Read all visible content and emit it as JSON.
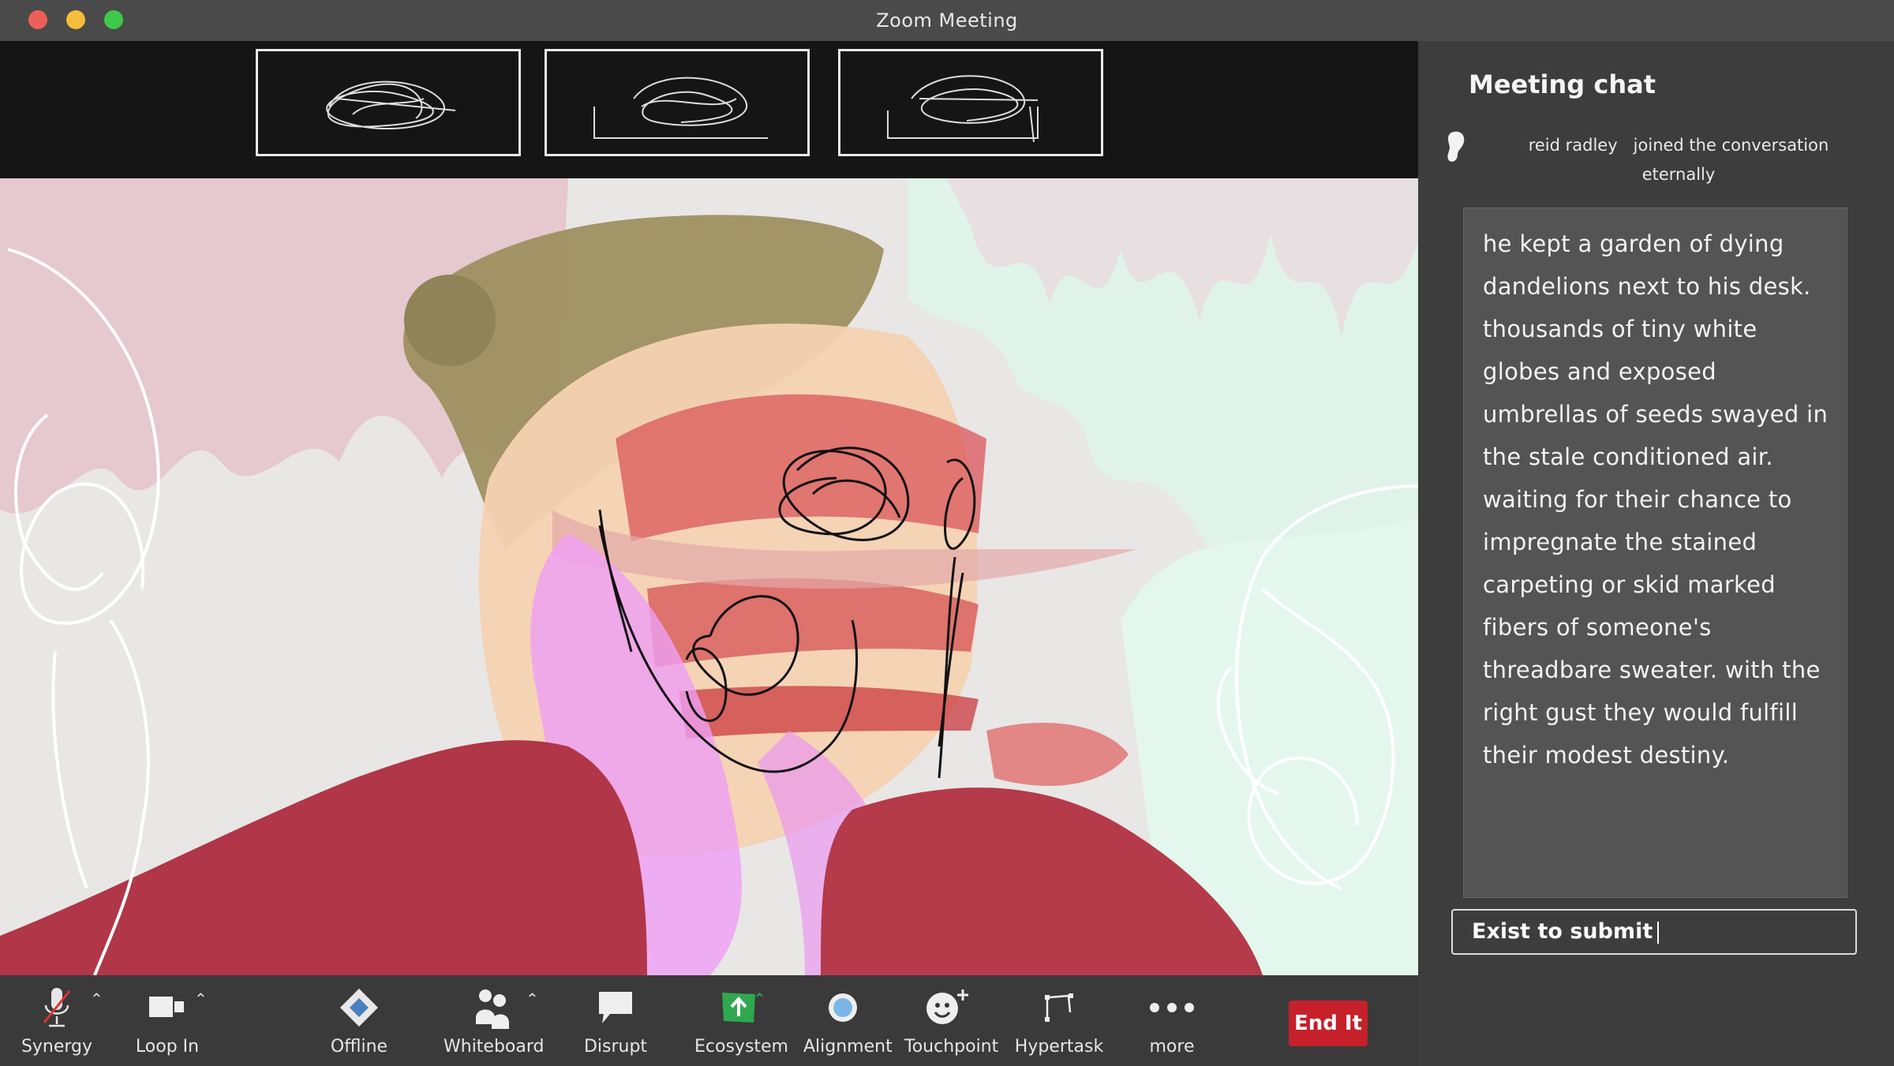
{
  "window": {
    "title": "Zoom Meeting"
  },
  "chat": {
    "title": "Meeting chat",
    "join_name": "reid radley",
    "join_text": "joined the conversation",
    "join_suffix": "eternally",
    "message": "he kept a garden of dying dandelions next to his desk. thousands of tiny white globes and exposed umbrellas of seeds swayed in the stale conditioned air. waiting for their chance to impregnate the stained carpeting or skid marked fibers of someone's threadbare sweater. with the right gust they would fulfill their modest destiny.",
    "input_placeholder": "Exist to submit"
  },
  "toolbar": {
    "items": [
      {
        "label": "Synergy",
        "icon": "microphone-muted-icon"
      },
      {
        "label": "Loop In",
        "icon": "video-camera-icon"
      },
      {
        "label": "Offline",
        "icon": "diamond-icon"
      },
      {
        "label": "Whiteboard",
        "icon": "participants-icon"
      },
      {
        "label": "Disrupt",
        "icon": "speech-bubble-icon"
      },
      {
        "label": "Ecosystem",
        "icon": "share-screen-icon"
      },
      {
        "label": "Alignment",
        "icon": "record-bubble-icon"
      },
      {
        "label": "Touchpoint",
        "icon": "reaction-icon"
      },
      {
        "label": "Hypertask",
        "icon": "apps-icon"
      },
      {
        "label": "more",
        "icon": "more-dots-icon"
      }
    ],
    "end_label": "End It"
  },
  "colors": {
    "end_button": "#c6202a",
    "share_green": "#2fa84f",
    "panel_bg": "#3d3d3d",
    "message_bg": "#545454"
  }
}
